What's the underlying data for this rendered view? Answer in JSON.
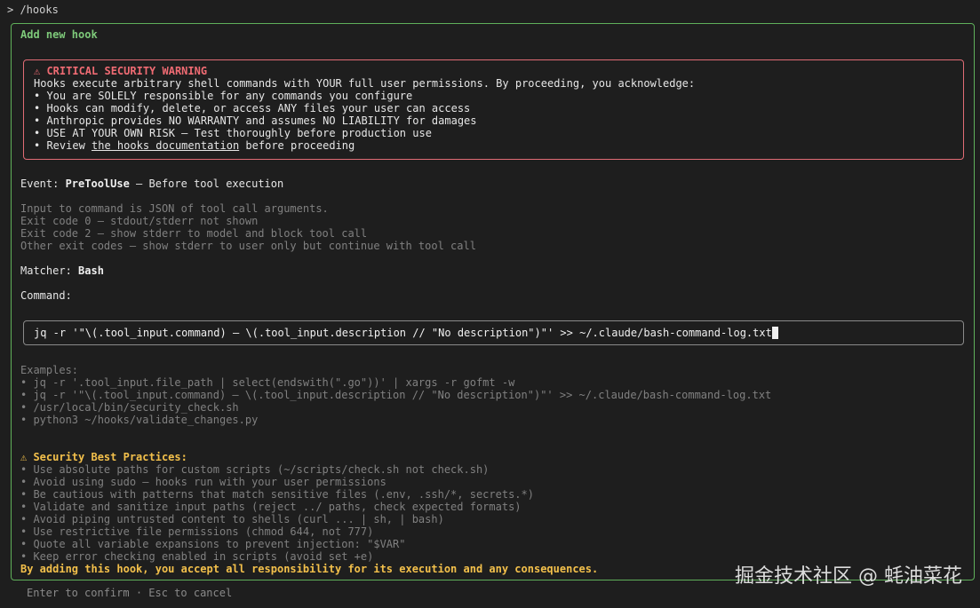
{
  "prompt": "> /hooks",
  "panel": {
    "title": "Add new hook",
    "warning": {
      "title": "⚠ CRITICAL SECURITY WARNING",
      "intro": "Hooks execute arbitrary shell commands with YOUR full user permissions. By proceeding, you acknowledge:",
      "items": [
        "• You are SOLELY responsible for any commands you configure",
        "• Hooks can modify, delete, or access ANY files your user can access",
        "• Anthropic provides NO WARRANTY and assumes NO LIABILITY for damages",
        "• USE AT YOUR OWN RISK – Test thoroughly before production use"
      ],
      "review_prefix": "• Review ",
      "review_link": "the hooks documentation",
      "review_suffix": " before proceeding"
    },
    "event": {
      "label": "Event: ",
      "name": "PreToolUse",
      "desc": " – Before tool execution"
    },
    "event_details": [
      "Input to command is JSON of tool call arguments.",
      "Exit code 0 – stdout/stderr not shown",
      "Exit code 2 – show stderr to model and block tool call",
      "Other exit codes – show stderr to user only but continue with tool call"
    ],
    "matcher": {
      "label": "Matcher: ",
      "value": "Bash"
    },
    "command": {
      "label": "Command:",
      "value": "jq -r '\"\\(.tool_input.command) – \\(.tool_input.description // \"No description\")\"' >> ~/.claude/bash-command-log.txt"
    },
    "examples": {
      "title": "Examples:",
      "items": [
        "• jq -r '.tool_input.file_path | select(endswith(\".go\"))' | xargs -r gofmt -w",
        "• jq -r '\"\\(.tool_input.command) – \\(.tool_input.description // \"No description\")\"' >> ~/.claude/bash-command-log.txt",
        "• /usr/local/bin/security_check.sh",
        "• python3 ~/hooks/validate_changes.py"
      ]
    },
    "security": {
      "title": "⚠ Security Best Practices:",
      "items": [
        "• Use absolute paths for custom scripts (~/scripts/check.sh not check.sh)",
        "• Avoid using sudo – hooks run with your user permissions",
        "• Be cautious with patterns that match sensitive files (.env, .ssh/*, secrets.*)",
        "• Validate and sanitize input paths (reject ../ paths, check expected formats)",
        "• Avoid piping untrusted content to shells (curl ... | sh, | bash)",
        "• Use restrictive file permissions (chmod 644, not 777)",
        "• Quote all variable expansions to prevent injection: \"$VAR\"",
        "• Keep error checking enabled in scripts (avoid set +e)"
      ]
    },
    "acceptance": "By adding this hook, you accept all responsibility for its execution and any consequences."
  },
  "footer": "Enter to confirm · Esc to cancel",
  "watermark": "掘金技术社区 @ 蚝油菜花"
}
